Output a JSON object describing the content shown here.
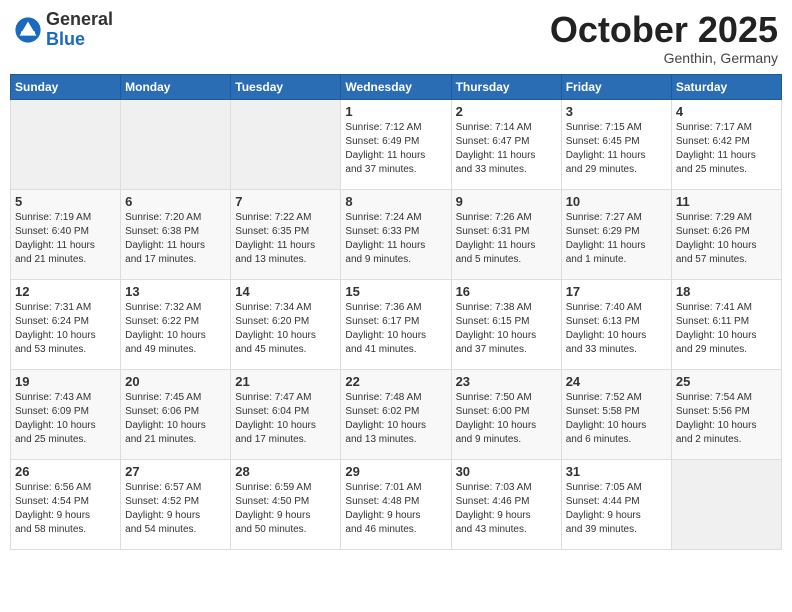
{
  "header": {
    "logo_general": "General",
    "logo_blue": "Blue",
    "month": "October 2025",
    "location": "Genthin, Germany"
  },
  "days_of_week": [
    "Sunday",
    "Monday",
    "Tuesday",
    "Wednesday",
    "Thursday",
    "Friday",
    "Saturday"
  ],
  "weeks": [
    [
      {
        "day": "",
        "info": ""
      },
      {
        "day": "",
        "info": ""
      },
      {
        "day": "",
        "info": ""
      },
      {
        "day": "1",
        "info": "Sunrise: 7:12 AM\nSunset: 6:49 PM\nDaylight: 11 hours\nand 37 minutes."
      },
      {
        "day": "2",
        "info": "Sunrise: 7:14 AM\nSunset: 6:47 PM\nDaylight: 11 hours\nand 33 minutes."
      },
      {
        "day": "3",
        "info": "Sunrise: 7:15 AM\nSunset: 6:45 PM\nDaylight: 11 hours\nand 29 minutes."
      },
      {
        "day": "4",
        "info": "Sunrise: 7:17 AM\nSunset: 6:42 PM\nDaylight: 11 hours\nand 25 minutes."
      }
    ],
    [
      {
        "day": "5",
        "info": "Sunrise: 7:19 AM\nSunset: 6:40 PM\nDaylight: 11 hours\nand 21 minutes."
      },
      {
        "day": "6",
        "info": "Sunrise: 7:20 AM\nSunset: 6:38 PM\nDaylight: 11 hours\nand 17 minutes."
      },
      {
        "day": "7",
        "info": "Sunrise: 7:22 AM\nSunset: 6:35 PM\nDaylight: 11 hours\nand 13 minutes."
      },
      {
        "day": "8",
        "info": "Sunrise: 7:24 AM\nSunset: 6:33 PM\nDaylight: 11 hours\nand 9 minutes."
      },
      {
        "day": "9",
        "info": "Sunrise: 7:26 AM\nSunset: 6:31 PM\nDaylight: 11 hours\nand 5 minutes."
      },
      {
        "day": "10",
        "info": "Sunrise: 7:27 AM\nSunset: 6:29 PM\nDaylight: 11 hours\nand 1 minute."
      },
      {
        "day": "11",
        "info": "Sunrise: 7:29 AM\nSunset: 6:26 PM\nDaylight: 10 hours\nand 57 minutes."
      }
    ],
    [
      {
        "day": "12",
        "info": "Sunrise: 7:31 AM\nSunset: 6:24 PM\nDaylight: 10 hours\nand 53 minutes."
      },
      {
        "day": "13",
        "info": "Sunrise: 7:32 AM\nSunset: 6:22 PM\nDaylight: 10 hours\nand 49 minutes."
      },
      {
        "day": "14",
        "info": "Sunrise: 7:34 AM\nSunset: 6:20 PM\nDaylight: 10 hours\nand 45 minutes."
      },
      {
        "day": "15",
        "info": "Sunrise: 7:36 AM\nSunset: 6:17 PM\nDaylight: 10 hours\nand 41 minutes."
      },
      {
        "day": "16",
        "info": "Sunrise: 7:38 AM\nSunset: 6:15 PM\nDaylight: 10 hours\nand 37 minutes."
      },
      {
        "day": "17",
        "info": "Sunrise: 7:40 AM\nSunset: 6:13 PM\nDaylight: 10 hours\nand 33 minutes."
      },
      {
        "day": "18",
        "info": "Sunrise: 7:41 AM\nSunset: 6:11 PM\nDaylight: 10 hours\nand 29 minutes."
      }
    ],
    [
      {
        "day": "19",
        "info": "Sunrise: 7:43 AM\nSunset: 6:09 PM\nDaylight: 10 hours\nand 25 minutes."
      },
      {
        "day": "20",
        "info": "Sunrise: 7:45 AM\nSunset: 6:06 PM\nDaylight: 10 hours\nand 21 minutes."
      },
      {
        "day": "21",
        "info": "Sunrise: 7:47 AM\nSunset: 6:04 PM\nDaylight: 10 hours\nand 17 minutes."
      },
      {
        "day": "22",
        "info": "Sunrise: 7:48 AM\nSunset: 6:02 PM\nDaylight: 10 hours\nand 13 minutes."
      },
      {
        "day": "23",
        "info": "Sunrise: 7:50 AM\nSunset: 6:00 PM\nDaylight: 10 hours\nand 9 minutes."
      },
      {
        "day": "24",
        "info": "Sunrise: 7:52 AM\nSunset: 5:58 PM\nDaylight: 10 hours\nand 6 minutes."
      },
      {
        "day": "25",
        "info": "Sunrise: 7:54 AM\nSunset: 5:56 PM\nDaylight: 10 hours\nand 2 minutes."
      }
    ],
    [
      {
        "day": "26",
        "info": "Sunrise: 6:56 AM\nSunset: 4:54 PM\nDaylight: 9 hours\nand 58 minutes."
      },
      {
        "day": "27",
        "info": "Sunrise: 6:57 AM\nSunset: 4:52 PM\nDaylight: 9 hours\nand 54 minutes."
      },
      {
        "day": "28",
        "info": "Sunrise: 6:59 AM\nSunset: 4:50 PM\nDaylight: 9 hours\nand 50 minutes."
      },
      {
        "day": "29",
        "info": "Sunrise: 7:01 AM\nSunset: 4:48 PM\nDaylight: 9 hours\nand 46 minutes."
      },
      {
        "day": "30",
        "info": "Sunrise: 7:03 AM\nSunset: 4:46 PM\nDaylight: 9 hours\nand 43 minutes."
      },
      {
        "day": "31",
        "info": "Sunrise: 7:05 AM\nSunset: 4:44 PM\nDaylight: 9 hours\nand 39 minutes."
      },
      {
        "day": "",
        "info": ""
      }
    ]
  ]
}
